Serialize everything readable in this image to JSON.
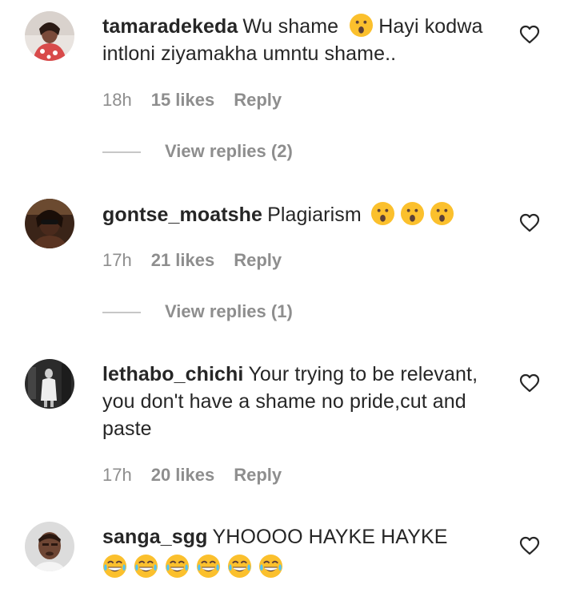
{
  "comments": [
    {
      "username": "tamaradekeda",
      "text_before": "Wu shame",
      "text_after": "Hayi kodwa intloni ziyamakha umntu shame..",
      "time": "18h",
      "likes": "15 likes",
      "reply": "Reply",
      "view_replies": "View replies (2)"
    },
    {
      "username": "gontse_moatshe",
      "text": "Plagiarism",
      "time": "17h",
      "likes": "21 likes",
      "reply": "Reply",
      "view_replies": "View replies (1)"
    },
    {
      "username": "lethabo_chichi",
      "text": "Your trying to be relevant, you don't have a shame no pride,cut and paste",
      "time": "17h",
      "likes": "20 likes",
      "reply": "Reply"
    },
    {
      "username": "sanga_sgg",
      "text": "YHOOOO HAYKE HAYKE"
    }
  ],
  "icons": {
    "heart": "heart-outline-icon",
    "surprised": "face-with-open-mouth-emoji",
    "laughing": "face-with-tears-of-joy-emoji"
  },
  "colors": {
    "text": "#262626",
    "meta": "#8e8e8e",
    "emoji_yellow": "#fbc02d"
  }
}
